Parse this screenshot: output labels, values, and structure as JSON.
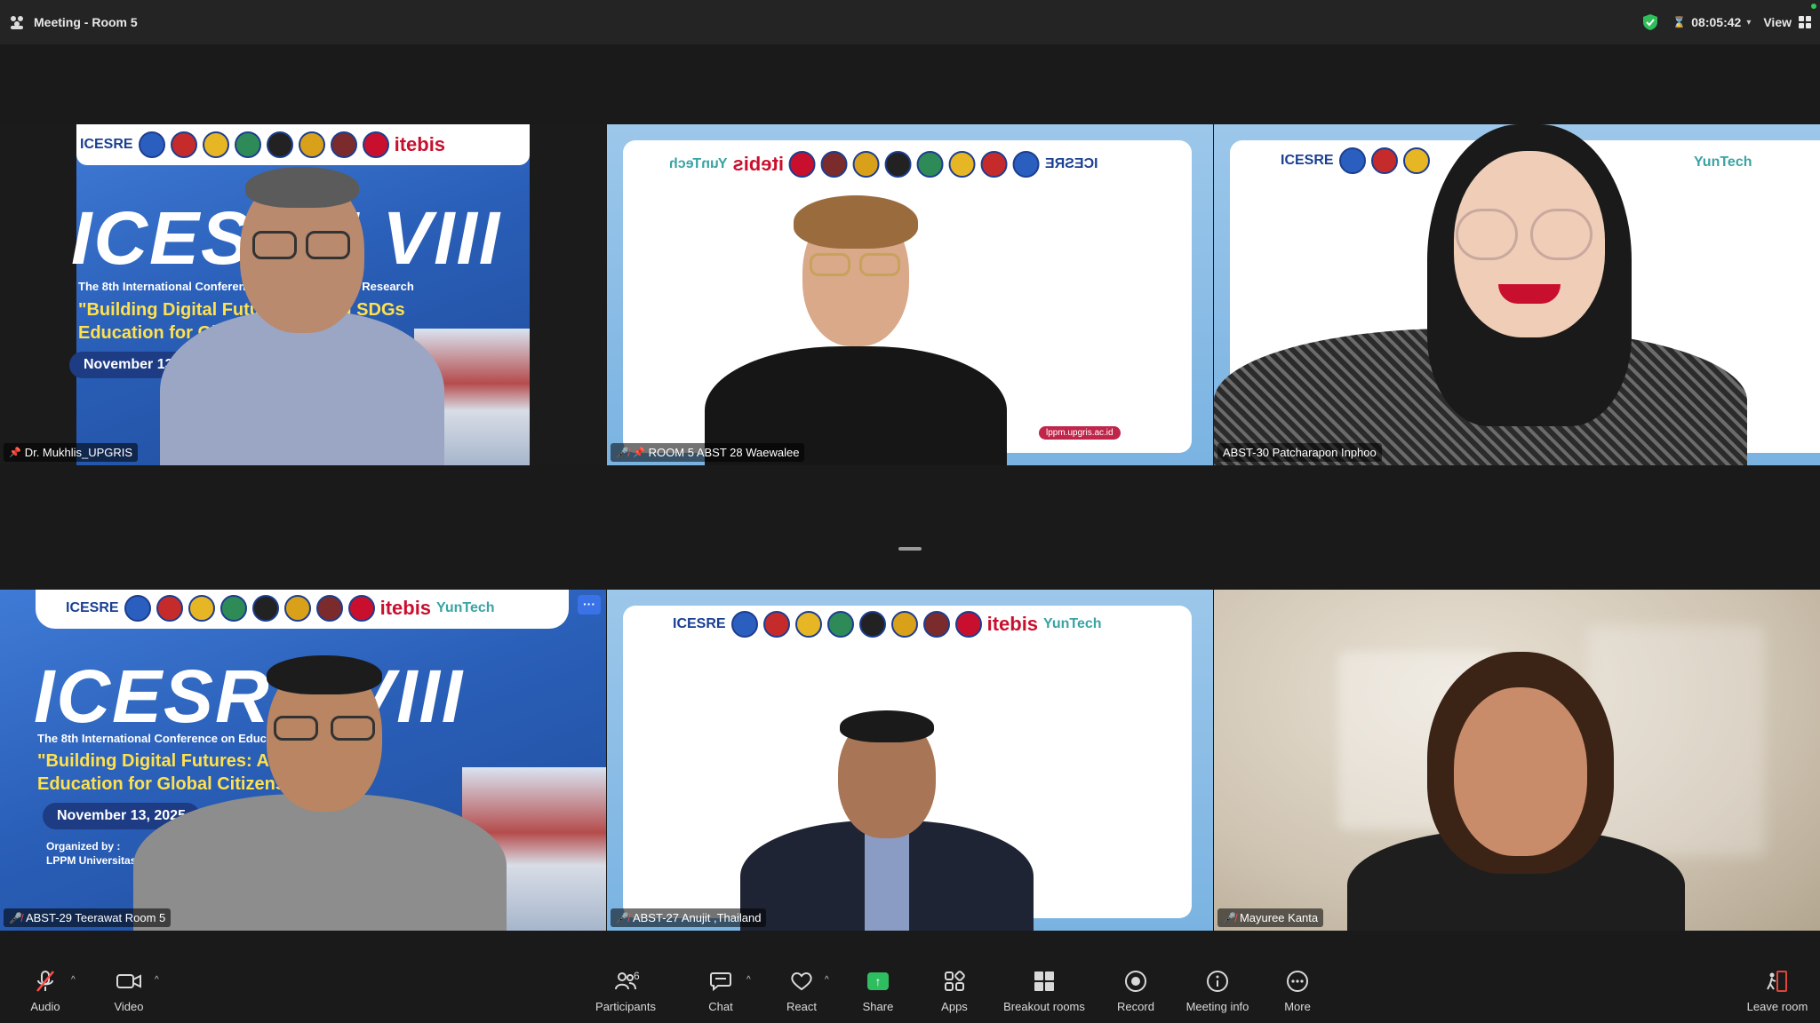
{
  "window": {
    "title": "Meeting - Room 5",
    "timer": "08:05:42",
    "view_label": "View"
  },
  "colors": {
    "active_speaker": "#47c24c",
    "share": "#2ebd5f",
    "leave": "#e0453a",
    "mic_off": "#ff4d4d"
  },
  "participants": [
    {
      "name": "Dr. Mukhlis_UPGRIS",
      "muted": false,
      "pinned": true,
      "active": true
    },
    {
      "name": "ROOM 5 ABST 28 Waewalee",
      "muted": true,
      "pinned": true,
      "active": false
    },
    {
      "name": "ABST-30 Patcharapon Inphoo",
      "muted": false,
      "pinned": false,
      "active": false
    },
    {
      "name": "ABST-29 Teerawat Room 5",
      "muted": true,
      "pinned": false,
      "active": false
    },
    {
      "name": "ABST-27 Anujit ,Thailand",
      "muted": true,
      "pinned": false,
      "active": false
    },
    {
      "name": "Mayuree  Kanta",
      "muted": true,
      "pinned": false,
      "active": false
    }
  ],
  "banner": {
    "brand_icesre": "ICESRE",
    "brand_itebis": "itebis",
    "brand_yuntech": "YunTech",
    "title_big": "ICESRE VIII",
    "conference_line": "The 8th International Conference on Education and Research",
    "theme_line1": "\"Building Digital Futures: AI and SDGs",
    "theme_line2": "Education for Global Citizens\"",
    "date": "November 13, 2025",
    "organized_by": "Organized by :",
    "organizer": "LPPM Universitas PGRI Semarang",
    "url_badge": "lppm.upgris.ac.id"
  },
  "toolbar": {
    "audio": "Audio",
    "video": "Video",
    "participants": "Participants",
    "participants_count": "6",
    "chat": "Chat",
    "react": "React",
    "share": "Share",
    "apps": "Apps",
    "breakout": "Breakout rooms",
    "record": "Record",
    "meeting_info": "Meeting info",
    "more": "More",
    "leave": "Leave room"
  }
}
